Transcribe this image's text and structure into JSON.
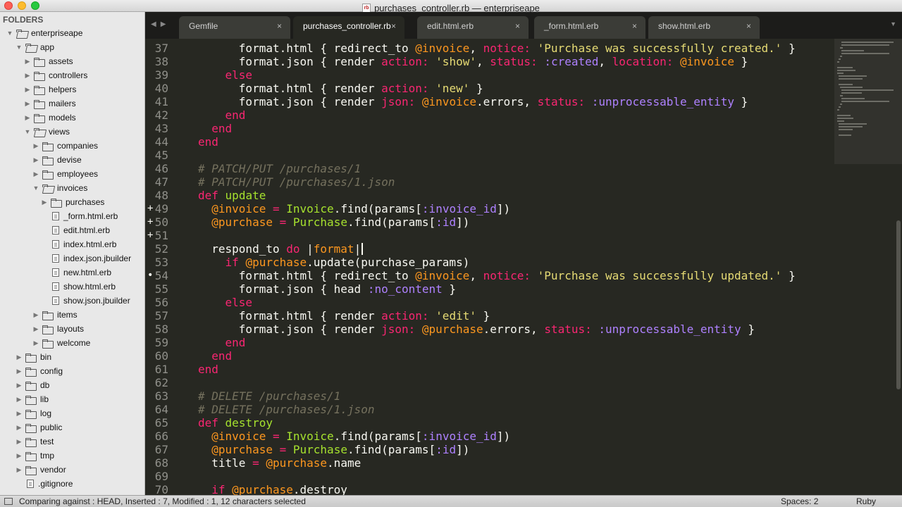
{
  "window": {
    "title": "purchases_controller.rb — enterpriseape",
    "file_badge": "rb"
  },
  "sidebar": {
    "heading": "FOLDERS",
    "items": [
      {
        "label": "enterpriseape",
        "kind": "folder",
        "depth": 0,
        "open": true
      },
      {
        "label": "app",
        "kind": "folder",
        "depth": 1,
        "open": true
      },
      {
        "label": "assets",
        "kind": "folder",
        "depth": 2,
        "open": false
      },
      {
        "label": "controllers",
        "kind": "folder",
        "depth": 2,
        "open": false
      },
      {
        "label": "helpers",
        "kind": "folder",
        "depth": 2,
        "open": false
      },
      {
        "label": "mailers",
        "kind": "folder",
        "depth": 2,
        "open": false
      },
      {
        "label": "models",
        "kind": "folder",
        "depth": 2,
        "open": false
      },
      {
        "label": "views",
        "kind": "folder",
        "depth": 2,
        "open": true
      },
      {
        "label": "companies",
        "kind": "folder",
        "depth": 3,
        "open": false
      },
      {
        "label": "devise",
        "kind": "folder",
        "depth": 3,
        "open": false
      },
      {
        "label": "employees",
        "kind": "folder",
        "depth": 3,
        "open": false
      },
      {
        "label": "invoices",
        "kind": "folder",
        "depth": 3,
        "open": true
      },
      {
        "label": "purchases",
        "kind": "folder",
        "depth": 4,
        "open": false
      },
      {
        "label": "_form.html.erb",
        "kind": "file",
        "depth": 4
      },
      {
        "label": "edit.html.erb",
        "kind": "file",
        "depth": 4
      },
      {
        "label": "index.html.erb",
        "kind": "file",
        "depth": 4
      },
      {
        "label": "index.json.jbuilder",
        "kind": "file",
        "depth": 4
      },
      {
        "label": "new.html.erb",
        "kind": "file",
        "depth": 4
      },
      {
        "label": "show.html.erb",
        "kind": "file",
        "depth": 4
      },
      {
        "label": "show.json.jbuilder",
        "kind": "file",
        "depth": 4
      },
      {
        "label": "items",
        "kind": "folder",
        "depth": 3,
        "open": false
      },
      {
        "label": "layouts",
        "kind": "folder",
        "depth": 3,
        "open": false
      },
      {
        "label": "welcome",
        "kind": "folder",
        "depth": 3,
        "open": false
      },
      {
        "label": "bin",
        "kind": "folder",
        "depth": 1,
        "open": false
      },
      {
        "label": "config",
        "kind": "folder",
        "depth": 1,
        "open": false
      },
      {
        "label": "db",
        "kind": "folder",
        "depth": 1,
        "open": false
      },
      {
        "label": "lib",
        "kind": "folder",
        "depth": 1,
        "open": false
      },
      {
        "label": "log",
        "kind": "folder",
        "depth": 1,
        "open": false
      },
      {
        "label": "public",
        "kind": "folder",
        "depth": 1,
        "open": false
      },
      {
        "label": "test",
        "kind": "folder",
        "depth": 1,
        "open": false
      },
      {
        "label": "tmp",
        "kind": "folder",
        "depth": 1,
        "open": false
      },
      {
        "label": "vendor",
        "kind": "folder",
        "depth": 1,
        "open": false
      },
      {
        "label": ".gitignore",
        "kind": "file",
        "depth": 1
      }
    ]
  },
  "tabs": [
    {
      "label": "Gemfile",
      "active": false
    },
    {
      "label": "purchases_controller.rb",
      "active": true
    },
    {
      "label": "edit.html.erb",
      "active": false
    },
    {
      "label": "_form.html.erb",
      "active": false
    },
    {
      "label": "show.html.erb",
      "active": false
    }
  ],
  "tab_close_glyph": "×",
  "editor": {
    "lines": [
      {
        "n": "37",
        "mark": "",
        "tokens": [
          [
            "",
            "      format.html { redirect_to "
          ],
          [
            "iv",
            "@invoice"
          ],
          [
            "",
            ", "
          ],
          [
            "kw",
            "notice:"
          ],
          [
            "",
            " "
          ],
          [
            "str",
            "'Purchase was successfully created.'"
          ],
          [
            "",
            " }"
          ]
        ]
      },
      {
        "n": "38",
        "mark": "",
        "tokens": [
          [
            "",
            "      format.json { render "
          ],
          [
            "kw",
            "action:"
          ],
          [
            "",
            " "
          ],
          [
            "str",
            "'show'"
          ],
          [
            "",
            ", "
          ],
          [
            "kw",
            "status:"
          ],
          [
            "",
            " "
          ],
          [
            "sym",
            ":created"
          ],
          [
            "",
            ", "
          ],
          [
            "kw",
            "location:"
          ],
          [
            "",
            " "
          ],
          [
            "iv",
            "@invoice"
          ],
          [
            "",
            " }"
          ]
        ]
      },
      {
        "n": "39",
        "mark": "",
        "tokens": [
          [
            "",
            "    "
          ],
          [
            "kw",
            "else"
          ]
        ]
      },
      {
        "n": "40",
        "mark": "",
        "tokens": [
          [
            "",
            "      format.html { render "
          ],
          [
            "kw",
            "action:"
          ],
          [
            "",
            " "
          ],
          [
            "str",
            "'new'"
          ],
          [
            "",
            " }"
          ]
        ]
      },
      {
        "n": "41",
        "mark": "",
        "tokens": [
          [
            "",
            "      format.json { render "
          ],
          [
            "kw",
            "json:"
          ],
          [
            "",
            " "
          ],
          [
            "iv",
            "@invoice"
          ],
          [
            "",
            ".errors, "
          ],
          [
            "kw",
            "status:"
          ],
          [
            "",
            " "
          ],
          [
            "sym",
            ":unprocessable_entity"
          ],
          [
            "",
            " }"
          ]
        ]
      },
      {
        "n": "42",
        "mark": "",
        "tokens": [
          [
            "",
            "    "
          ],
          [
            "kw",
            "end"
          ]
        ]
      },
      {
        "n": "43",
        "mark": "",
        "tokens": [
          [
            "",
            "  "
          ],
          [
            "kw",
            "end"
          ]
        ]
      },
      {
        "n": "44",
        "mark": "",
        "tokens": [
          [
            "kw",
            "end"
          ]
        ]
      },
      {
        "n": "45",
        "mark": "",
        "tokens": []
      },
      {
        "n": "46",
        "mark": "",
        "tokens": [
          [
            "cmt",
            "# PATCH/PUT /purchases/1"
          ]
        ]
      },
      {
        "n": "47",
        "mark": "",
        "tokens": [
          [
            "cmt",
            "# PATCH/PUT /purchases/1.json"
          ]
        ]
      },
      {
        "n": "48",
        "mark": "",
        "tokens": [
          [
            "kw",
            "def"
          ],
          [
            "",
            " "
          ],
          [
            "fn",
            "update"
          ]
        ]
      },
      {
        "n": "49",
        "mark": "+",
        "tokens": [
          [
            "",
            "  "
          ],
          [
            "iv",
            "@invoice"
          ],
          [
            "",
            " "
          ],
          [
            "kw",
            "="
          ],
          [
            "",
            " "
          ],
          [
            "fn",
            "Invoice"
          ],
          [
            "",
            ".find(params["
          ],
          [
            "sym",
            ":invoice_id"
          ],
          [
            "",
            "])"
          ]
        ]
      },
      {
        "n": "50",
        "mark": "+",
        "tokens": [
          [
            "",
            "  "
          ],
          [
            "iv",
            "@purchase"
          ],
          [
            "",
            " "
          ],
          [
            "kw",
            "="
          ],
          [
            "",
            " "
          ],
          [
            "fn",
            "Purchase"
          ],
          [
            "",
            ".find(params["
          ],
          [
            "sym",
            ":id"
          ],
          [
            "",
            "])"
          ]
        ]
      },
      {
        "n": "51",
        "mark": "+",
        "tokens": []
      },
      {
        "n": "52",
        "mark": "",
        "tokens": [
          [
            "",
            "  respond_to "
          ],
          [
            "kw",
            "do"
          ],
          [
            "",
            " |"
          ],
          [
            "iv",
            "format"
          ],
          [
            "",
            "|"
          ]
        ],
        "cursor": true
      },
      {
        "n": "53",
        "mark": "",
        "tokens": [
          [
            "",
            "    "
          ],
          [
            "kw",
            "if"
          ],
          [
            "",
            " "
          ],
          [
            "iv",
            "@purchase"
          ],
          [
            "",
            ".update(purchase_params)"
          ]
        ]
      },
      {
        "n": "54",
        "mark": "•",
        "tokens": [
          [
            "",
            "      format.html { redirect_to "
          ],
          [
            "iv",
            "@invoice"
          ],
          [
            "",
            ", "
          ],
          [
            "kw",
            "notice:"
          ],
          [
            "",
            " "
          ],
          [
            "str",
            "'Purchase was successfully updated.'"
          ],
          [
            "",
            " }"
          ]
        ]
      },
      {
        "n": "55",
        "mark": "",
        "tokens": [
          [
            "",
            "      format.json { head "
          ],
          [
            "sym",
            ":no_content"
          ],
          [
            "",
            " }"
          ]
        ]
      },
      {
        "n": "56",
        "mark": "",
        "tokens": [
          [
            "",
            "    "
          ],
          [
            "kw",
            "else"
          ]
        ]
      },
      {
        "n": "57",
        "mark": "",
        "tokens": [
          [
            "",
            "      format.html { render "
          ],
          [
            "kw",
            "action:"
          ],
          [
            "",
            " "
          ],
          [
            "str",
            "'edit'"
          ],
          [
            "",
            " }"
          ]
        ]
      },
      {
        "n": "58",
        "mark": "",
        "tokens": [
          [
            "",
            "      format.json { render "
          ],
          [
            "kw",
            "json:"
          ],
          [
            "",
            " "
          ],
          [
            "iv",
            "@purchase"
          ],
          [
            "",
            ".errors, "
          ],
          [
            "kw",
            "status:"
          ],
          [
            "",
            " "
          ],
          [
            "sym",
            ":unprocessable_entity"
          ],
          [
            "",
            " }"
          ]
        ]
      },
      {
        "n": "59",
        "mark": "",
        "tokens": [
          [
            "",
            "    "
          ],
          [
            "kw",
            "end"
          ]
        ]
      },
      {
        "n": "60",
        "mark": "",
        "tokens": [
          [
            "",
            "  "
          ],
          [
            "kw",
            "end"
          ]
        ]
      },
      {
        "n": "61",
        "mark": "",
        "tokens": [
          [
            "kw",
            "end"
          ]
        ]
      },
      {
        "n": "62",
        "mark": "",
        "tokens": []
      },
      {
        "n": "63",
        "mark": "",
        "tokens": [
          [
            "cmt",
            "# DELETE /purchases/1"
          ]
        ]
      },
      {
        "n": "64",
        "mark": "",
        "tokens": [
          [
            "cmt",
            "# DELETE /purchases/1.json"
          ]
        ]
      },
      {
        "n": "65",
        "mark": "",
        "tokens": [
          [
            "kw",
            "def"
          ],
          [
            "",
            " "
          ],
          [
            "fn",
            "destroy"
          ]
        ]
      },
      {
        "n": "66",
        "mark": "",
        "tokens": [
          [
            "",
            "  "
          ],
          [
            "iv",
            "@invoice"
          ],
          [
            "",
            " "
          ],
          [
            "kw",
            "="
          ],
          [
            "",
            " "
          ],
          [
            "fn",
            "Invoice"
          ],
          [
            "",
            ".find(params["
          ],
          [
            "sym",
            ":invoice_id"
          ],
          [
            "",
            "])"
          ]
        ]
      },
      {
        "n": "67",
        "mark": "",
        "tokens": [
          [
            "",
            "  "
          ],
          [
            "iv",
            "@purchase"
          ],
          [
            "",
            " "
          ],
          [
            "kw",
            "="
          ],
          [
            "",
            " "
          ],
          [
            "fn",
            "Purchase"
          ],
          [
            "",
            ".find(params["
          ],
          [
            "sym",
            ":id"
          ],
          [
            "",
            "])"
          ]
        ]
      },
      {
        "n": "68",
        "mark": "",
        "tokens": [
          [
            "",
            "  title "
          ],
          [
            "kw",
            "="
          ],
          [
            "",
            " "
          ],
          [
            "iv",
            "@purchase"
          ],
          [
            "",
            ".name"
          ]
        ]
      },
      {
        "n": "69",
        "mark": "",
        "tokens": []
      },
      {
        "n": "70",
        "mark": "",
        "tokens": [
          [
            "",
            "  "
          ],
          [
            "kw",
            "if"
          ],
          [
            "",
            " "
          ],
          [
            "iv",
            "@purchase"
          ],
          [
            "",
            ".destroy"
          ]
        ]
      }
    ]
  },
  "status": {
    "message": "Comparing against : HEAD, Inserted : 7, Modified : 1, 12 characters selected",
    "indentation": "Spaces: 2",
    "syntax": "Ruby"
  },
  "colors": {
    "editor_bg": "#272822",
    "keyword": "#f92672",
    "function": "#a6e22e",
    "variable": "#fd971f",
    "symbol": "#ae81ff",
    "string": "#e6db74",
    "comment": "#75715e"
  }
}
